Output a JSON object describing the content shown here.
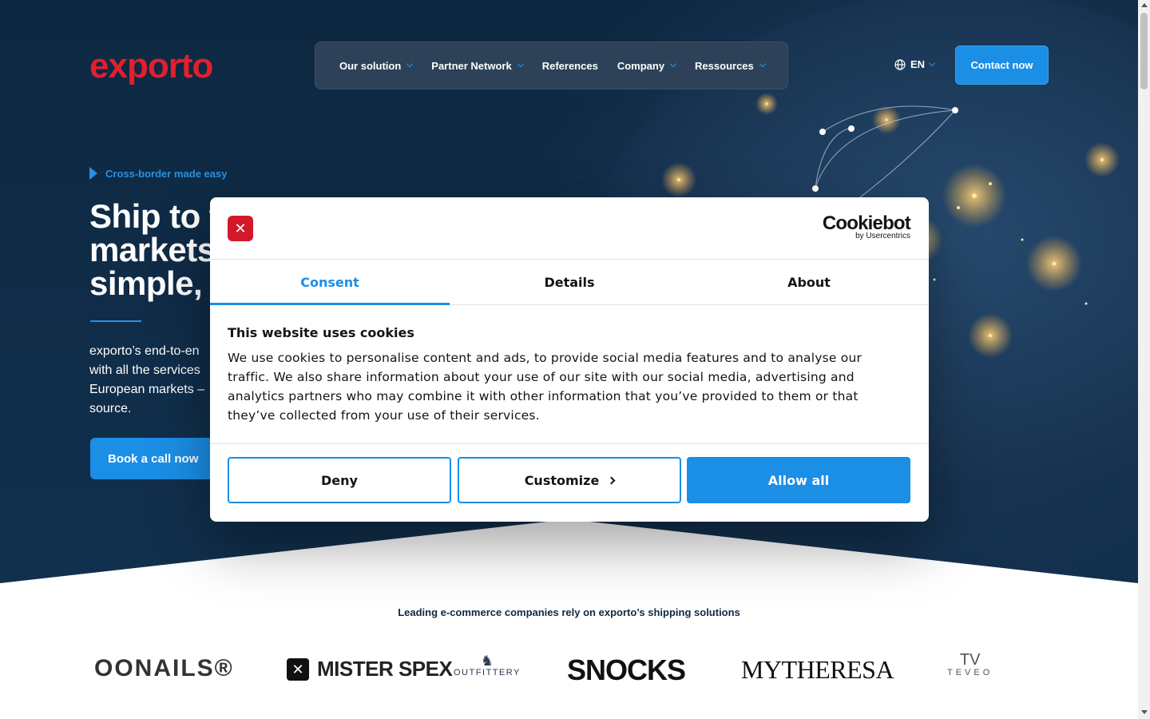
{
  "header": {
    "logo_text": "exporto",
    "nav": [
      {
        "label": "Our solution",
        "has_dropdown": true
      },
      {
        "label": "Partner Network",
        "has_dropdown": true
      },
      {
        "label": "References",
        "has_dropdown": false
      },
      {
        "label": "Company",
        "has_dropdown": true
      },
      {
        "label": "Ressources",
        "has_dropdown": true
      }
    ],
    "language": "EN",
    "contact_button": "Contact now"
  },
  "hero": {
    "eyebrow": "Cross-border made easy",
    "headline_lines": [
      "Ship to t",
      "markets",
      "simple, f"
    ],
    "text_lines": [
      "exporto’s end-to-en",
      "with all the services",
      "European markets –",
      "source."
    ],
    "cta": "Book a call now"
  },
  "trust": {
    "heading": "Leading e-commerce companies rely on exporto’s shipping solutions",
    "brands": [
      "OONAILS®",
      "MISTER SPEX",
      "OUTFITTERY",
      "SNOCKS",
      "MYTHERESA",
      "TEVEO"
    ]
  },
  "cookie_dialog": {
    "brand_name": "Cookiebot",
    "brand_sub": "by Usercentrics",
    "tabs": [
      "Consent",
      "Details",
      "About"
    ],
    "active_tab": "Consent",
    "title": "This website uses cookies",
    "description": "We use cookies to personalise content and ads, to provide social media features and to analyse our traffic. We also share information about your use of our site with our social media, advertising and analytics partners who may combine it with other information that you’ve provided to them or that they’ve collected from your use of their services.",
    "buttons": {
      "deny": "Deny",
      "customize": "Customize",
      "allow": "Allow all"
    }
  },
  "colors": {
    "hero_bg": "#0f2a44",
    "brand_red": "#e01f2f",
    "accent_blue": "#1b8ee6"
  }
}
